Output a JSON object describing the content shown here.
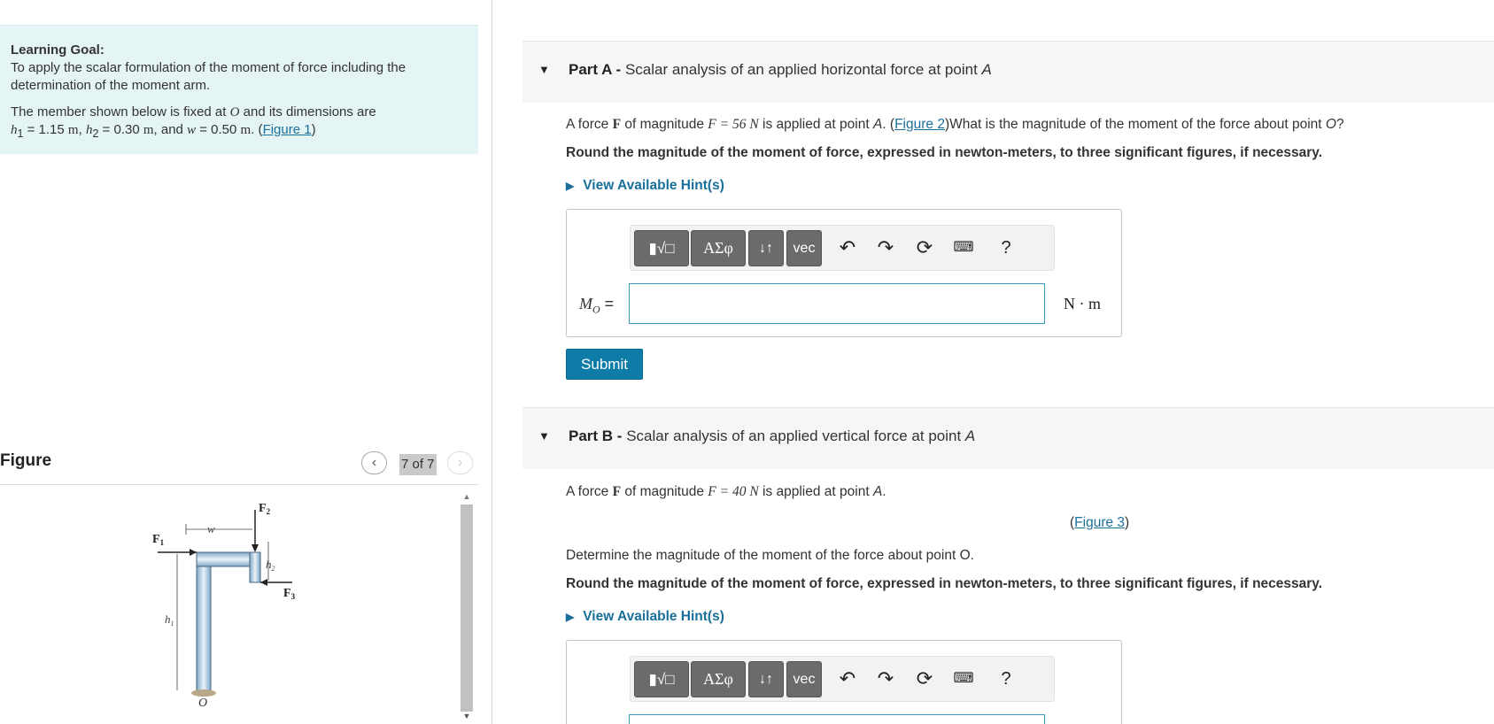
{
  "learning_goal": {
    "title": "Learning Goal:",
    "text": "To apply the scalar formulation of the moment of force including the determination of the moment arm.",
    "member_text_1": "The member shown below is fixed at",
    "point_o": "O",
    "member_text_2": "and its dimensions are",
    "h1_var": "h",
    "h1_sub": "1",
    "h1_value": " = 1.15 ",
    "h2_var": "h",
    "h2_sub": "2",
    "h2_value": " = 0.30 ",
    "w_var": "w",
    "w_value": " = 0.50 ",
    "unit_m": "m",
    "sep_and": ", and ",
    "sep_comma": ", ",
    "period": ". (",
    "figure_link": "Figure 1",
    "close_paren": ")"
  },
  "figure_panel": {
    "title": "Figure",
    "prev_icon": "chevron-left",
    "counter": "7 of 7",
    "next_icon": "chevron-right",
    "labels": {
      "F1": "F",
      "F1_sub": "1",
      "F2": "F",
      "F2_sub": "2",
      "F3": "F",
      "F3_sub": "3",
      "w": "w",
      "h1": "h",
      "h1_sub": "1",
      "h2": "h",
      "h2_sub": "2",
      "O": "O"
    }
  },
  "part_a": {
    "label": "Part A -",
    "title": "Scalar analysis of an applied horizontal force at point",
    "title_point": "A",
    "q_prefix": "A force",
    "q_F": "F",
    "q_mag": "of magnitude",
    "q_eq": "F = 56 N",
    "q_applied": "is applied at point",
    "q_point": "A",
    "q_open": ". (",
    "q_link": "Figure 2",
    "q_close": ")What is the magnitude of the moment of the force about point",
    "q_o": "O",
    "q_end": "?",
    "instruction": "Round the magnitude of the moment of force, expressed in newton-meters, to three significant figures, if necessary.",
    "hint": "View Available Hint(s)",
    "answer_label": "M",
    "answer_sub": "O",
    "answer_eq": " =",
    "answer_value": "",
    "unit": "N · m",
    "submit": "Submit"
  },
  "part_b": {
    "label": "Part B -",
    "title": "Scalar analysis of an applied vertical force at point",
    "title_point": "A",
    "q_prefix": "A force",
    "q_F": "F",
    "q_mag": "of magnitude",
    "q_eq": "F = 40 N",
    "q_applied": "is applied at point",
    "q_point": "A",
    "q_end": ".",
    "fig_open": "(",
    "fig_link": "Figure 3",
    "fig_close": ")",
    "q2": "Determine the magnitude of the moment of the force about point O.",
    "instruction": "Round the magnitude of the moment of force, expressed in newton-meters, to three significant figures, if necessary.",
    "hint": "View Available Hint(s)"
  },
  "toolbar": {
    "templates": "▮√□",
    "greek": "ΑΣφ",
    "arrows": "↓↑",
    "vec": "vec",
    "help": "?",
    "icons": [
      "undo-icon",
      "redo-icon",
      "reset-icon",
      "keyboard-icon"
    ]
  },
  "colors": {
    "goal_bg": "#e5f5f5",
    "link": "#1a6f9b",
    "submit_bg": "#0f7ca8",
    "toolbar_btn": "#6b6b6b",
    "input_border": "#3d9ab8"
  }
}
